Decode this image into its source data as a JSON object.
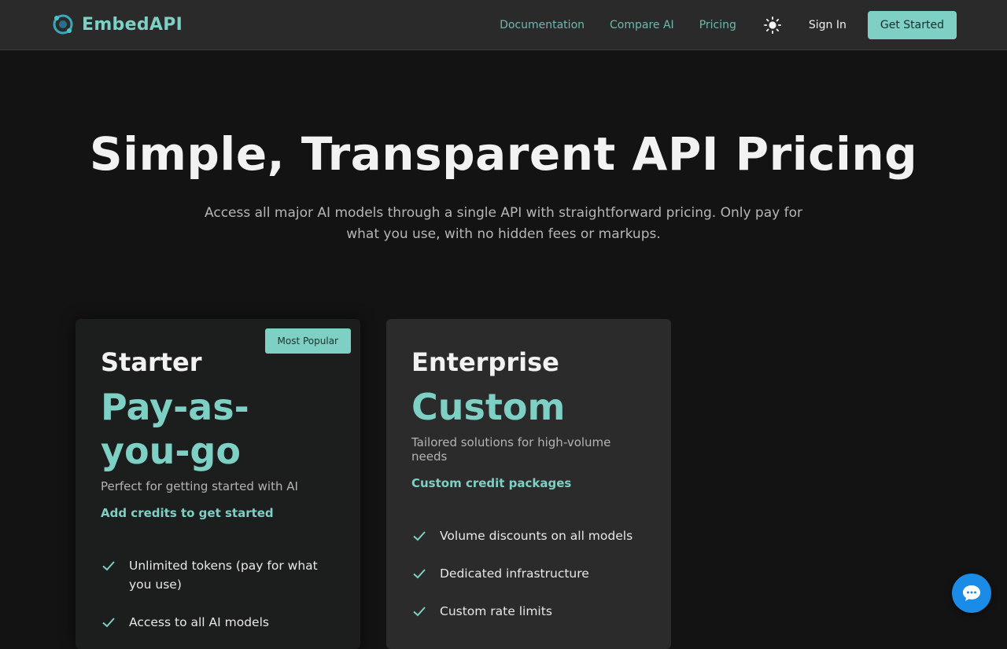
{
  "nav": {
    "brand": "EmbedAPI",
    "links": [
      "Documentation",
      "Compare AI",
      "Pricing"
    ],
    "theme_icon": "sun-icon",
    "sign_in": "Sign In",
    "cta": "Get Started"
  },
  "hero": {
    "title": "Simple, Transparent API Pricing",
    "subtitle": "Access all major AI models through a single API with straightforward pricing. Only pay for what you use, with no hidden fees or markups."
  },
  "plans": [
    {
      "badge": "Most Popular",
      "name": "Starter",
      "price": "Pay-as-you-go",
      "description": "Perfect for getting started with AI",
      "note": "Add credits to get started",
      "features": [
        "Unlimited tokens (pay for what you use)",
        "Access to all AI models"
      ]
    },
    {
      "name": "Enterprise",
      "price": "Custom",
      "description": "Tailored solutions for high-volume needs",
      "note": "Custom credit packages",
      "features": [
        "Volume discounts on all models",
        "Dedicated infrastructure",
        "Custom rate limits"
      ]
    }
  ],
  "colors": {
    "accent": "#7ecfc4",
    "background": "#131313",
    "nav": "#2a2a2a",
    "chat": "#1b8be8"
  }
}
